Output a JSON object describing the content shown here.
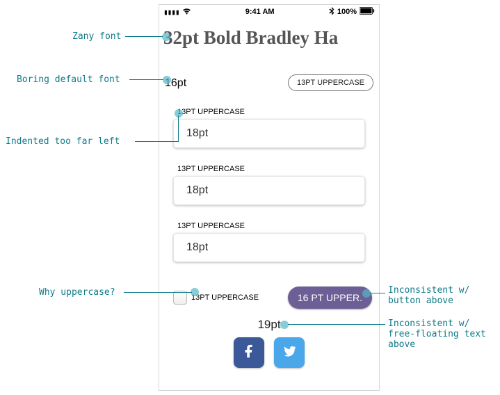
{
  "status": {
    "signal": "ıılⵊ",
    "wifi": "wifi",
    "time": "9:41 AM",
    "bt": "bt",
    "batt_pct": "100%"
  },
  "title": "32pt Bold Bradley Ha",
  "top": {
    "left_text": "16pt",
    "button": "13PT UPPERCASE"
  },
  "groups": [
    {
      "label": "13PT UPPERCASE",
      "field": "18pt"
    },
    {
      "label": "13PT UPPERCASE",
      "field": "18pt"
    },
    {
      "label": "13PT UPPERCASE",
      "field": "18pt"
    }
  ],
  "check": {
    "label": "13PT UPPERCASE",
    "button": "16 PT UPPER."
  },
  "freetext": "19pt",
  "annotations": {
    "zany": "Zany font",
    "boring": "Boring default font",
    "indent": "Indented too far left",
    "why": "Why uppercase?",
    "incons_btn": "Inconsistent w/\nbutton above",
    "incons_text": "Inconsistent w/\nfree-floating text\nabove"
  }
}
